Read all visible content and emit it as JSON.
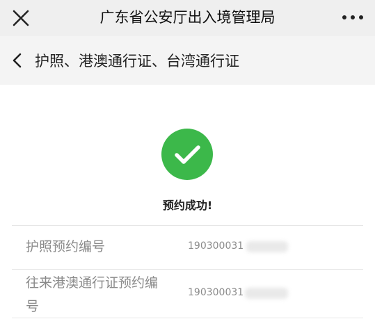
{
  "titlebar": {
    "title": "广东省公安厅出入境管理局",
    "close_icon": "close-icon",
    "more_icon": "more-dots-icon"
  },
  "subheader": {
    "back_icon": "chevron-left-icon",
    "title": "护照、港澳通行证、台湾通行证"
  },
  "result": {
    "icon": "check-circle-icon",
    "icon_color": "#3cb84a",
    "message": "预约成功!"
  },
  "details": [
    {
      "label": "护照预约编号",
      "value": "190300031"
    },
    {
      "label_line1": "往来港澳通行证预约编",
      "label_line2": "号",
      "value": "190300031"
    }
  ]
}
